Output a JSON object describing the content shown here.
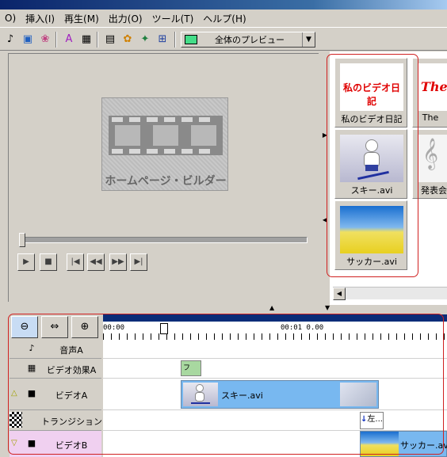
{
  "menu": {
    "items": [
      "O)",
      "挿入(I)",
      "再生(M)",
      "出力(O)",
      "ツール(T)",
      "ヘルプ(H)"
    ]
  },
  "toolbar": {
    "icons": [
      "music-note-icon",
      "image-icon",
      "effects-icon",
      "text-effect-icon",
      "grid-icon",
      "save-icon",
      "palette-icon",
      "wizard-icon",
      "transition-icon"
    ],
    "preview_select": "全体のプレビュー"
  },
  "preview": {
    "logo_text": "ホームページ・ビルダー",
    "seek_position": 0.0
  },
  "library": {
    "clips": [
      {
        "label": "私のビデオ日記",
        "thumb_text": "私のビデオ日記",
        "kind": "title"
      },
      {
        "label": "The",
        "thumb_text": "The",
        "kind": "title-en"
      },
      {
        "label": "スキー.avi",
        "kind": "ski"
      },
      {
        "label": "発表会",
        "kind": "music"
      },
      {
        "label": "サッカー.avi",
        "kind": "soccer"
      }
    ]
  },
  "timeline": {
    "ruler": {
      "start": "00:00",
      "mid": "00:01 0.00"
    },
    "tracks": [
      {
        "label": "音声A",
        "icon": "music-note-icon"
      },
      {
        "label": "ビデオ効果A",
        "icon": "grid-icon"
      },
      {
        "label": "ビデオA",
        "icon": "camera-icon"
      },
      {
        "label": "トランジション",
        "icon": "checker-icon"
      },
      {
        "label": "ビデオB",
        "icon": "camera-icon"
      }
    ],
    "fx_label": "フェ...",
    "video_a_clip": "スキー.avi",
    "transition_label": "左...",
    "video_b_clip": "サッカー.avi"
  },
  "colors": {
    "accent_red": "#d02020",
    "clip_blue": "#78b8f0",
    "ruler_bar": "#0a2c78"
  }
}
